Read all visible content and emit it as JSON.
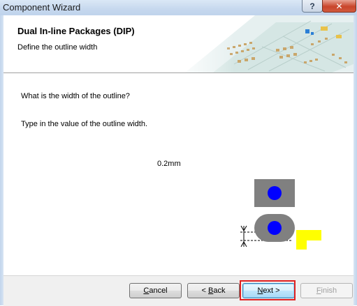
{
  "window": {
    "title": "Component Wizard",
    "help_label": "?",
    "close_label": "✕"
  },
  "header": {
    "title": "Dual In-line Packages (DIP)",
    "subtitle": "Define the outline width"
  },
  "content": {
    "question": "What is the width of the outline?",
    "instruction": "Type in the value of the outline width.",
    "outline_width_value": "0.2mm"
  },
  "footer": {
    "cancel_label": "Cancel",
    "cancel_mnemonic": "C",
    "back_label": "< Back",
    "back_prefix": "< ",
    "back_mnemonic": "B",
    "back_rest": "ack",
    "next_label": "Next >",
    "next_mnemonic": "N",
    "next_rest": "ext >",
    "finish_label": "Finish",
    "finish_mnemonic": "F",
    "finish_rest": "inish"
  },
  "colors": {
    "outline_silkscreen": "#ffff00",
    "pad_body": "#808080",
    "drill_hole": "#0000ff",
    "highlight_border": "#e02020"
  }
}
